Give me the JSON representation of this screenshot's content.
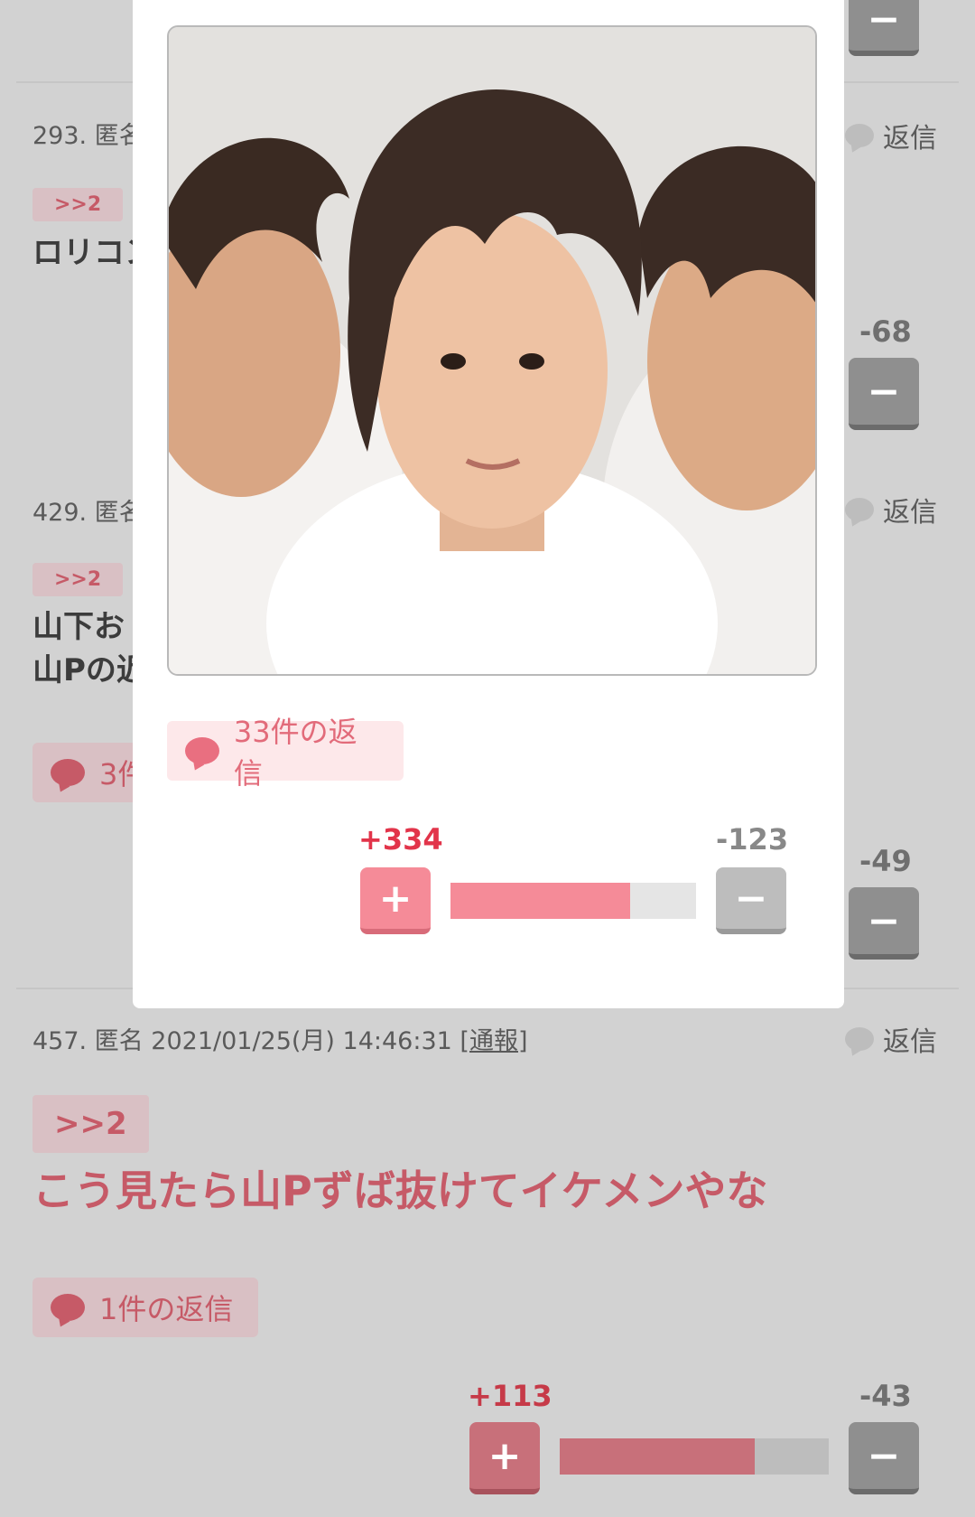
{
  "comments": [
    {
      "meta_prefix": "293. 匿名",
      "reply_label": "返信",
      "anchor": ">>2",
      "text_fragment": "ロリコン",
      "minus_score": "-68"
    },
    {
      "meta_prefix": "429. 匿名",
      "reply_label": "返信",
      "anchor": ">>2",
      "line1_fragment": "山下お",
      "line2_fragment": "山Pの近",
      "reply_count_fragment": "3件",
      "minus_score": "-49"
    },
    {
      "meta": "457. 匿名 2021/01/25(月) 14:46:31",
      "report_label": "[通報]",
      "reply_label": "返信",
      "anchor": ">>2",
      "text": "こう見たら山Pずば抜けてイケメンやな",
      "reply_count": "1件の返信",
      "plus_score": "+113",
      "minus_score": "-43",
      "plus_ratio": 0.724
    }
  ],
  "modal": {
    "reply_count": "33件の返信",
    "plus_score": "+334",
    "minus_score": "-123",
    "plus_ratio": 0.731
  },
  "icons": {
    "plus": "+",
    "minus": "−"
  },
  "colors": {
    "accent_pink": "#e96f80",
    "plus_score": "#e2344a"
  }
}
